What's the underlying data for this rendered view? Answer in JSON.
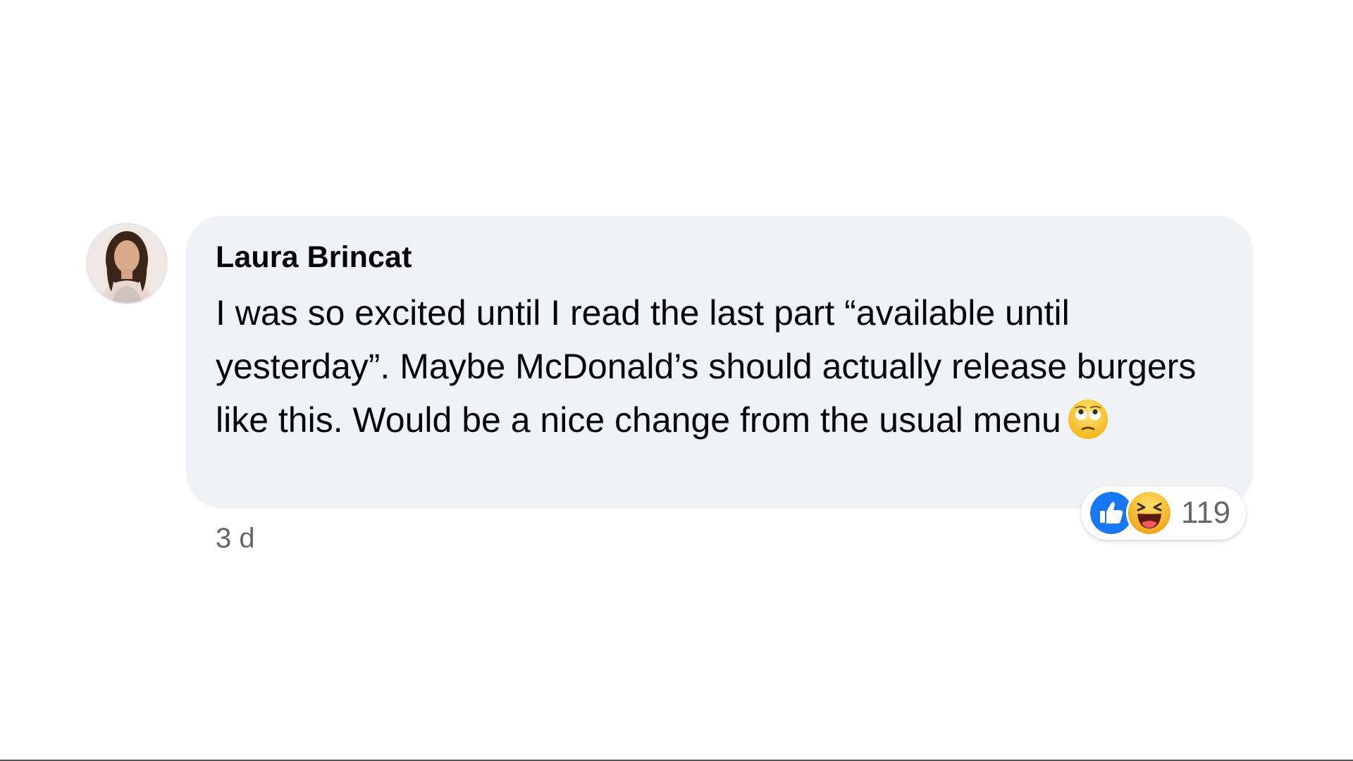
{
  "comment": {
    "author": "Laura Brincat",
    "text": "I was so excited until I read the last part “available until yesterday”. Maybe McDonald’s should actually release burgers like this. Would be a nice change from the usual menu",
    "inline_emoji": "face-with-rolling-eyes-emoji",
    "timestamp": "3 d",
    "reactions": {
      "types": [
        "like-reaction-icon",
        "haha-reaction-icon"
      ],
      "count": "119"
    }
  },
  "colors": {
    "bubble": "#f0f2f5",
    "text": "#050505",
    "muted": "#65676b",
    "like_blue": "#1877f2",
    "haha_yellow": "#f7b125"
  }
}
